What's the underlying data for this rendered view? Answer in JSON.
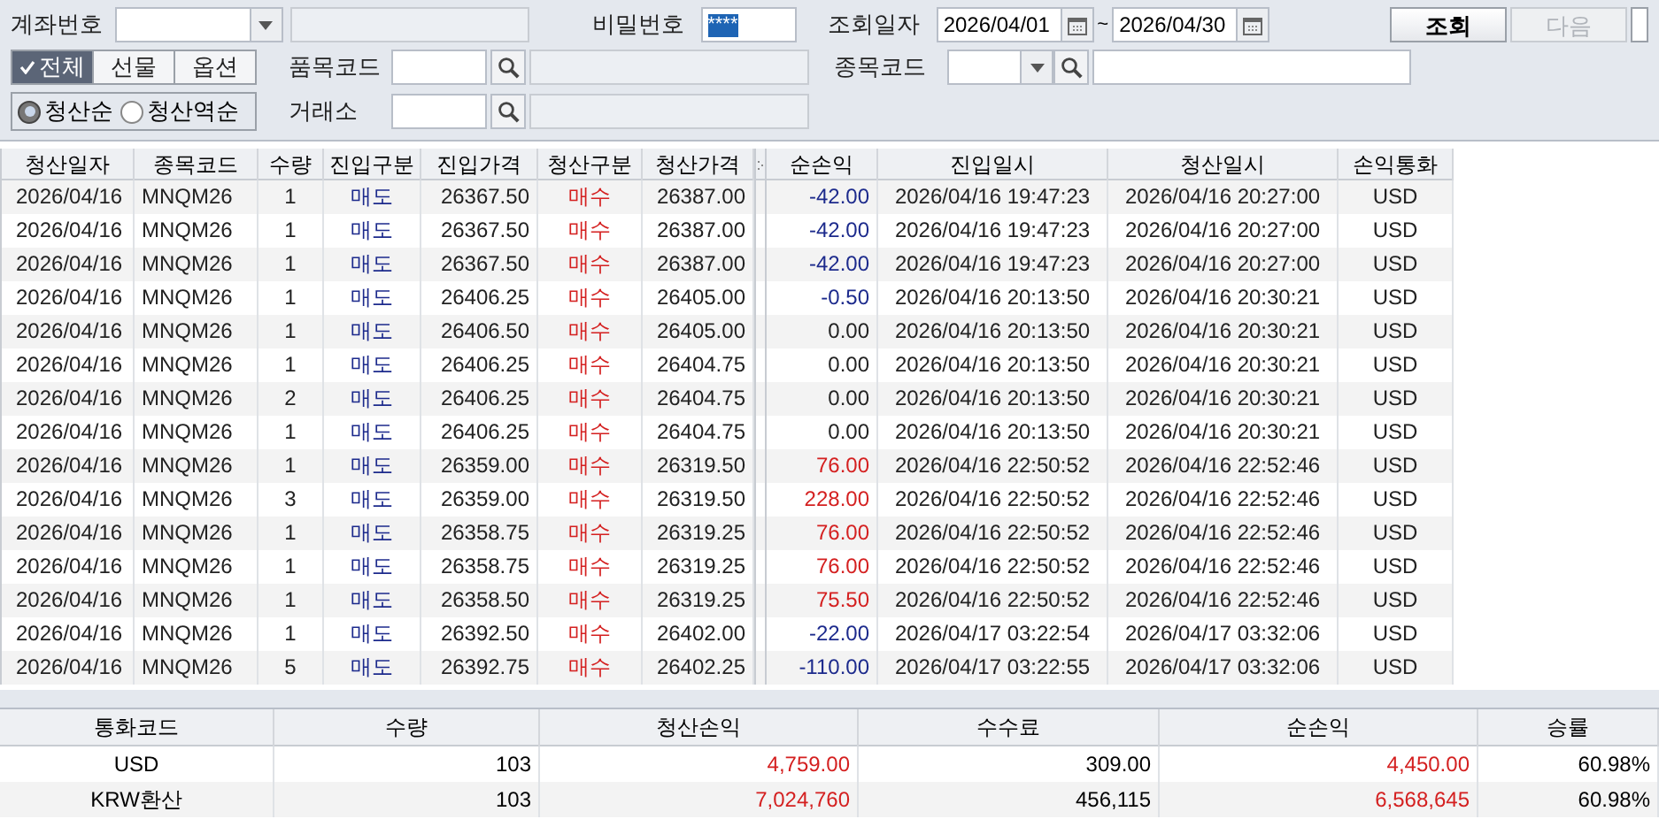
{
  "filters": {
    "account": {
      "label": "계좌번호"
    },
    "password": {
      "label": "비밀번호",
      "value": "****"
    },
    "date_range": {
      "label": "조회일자",
      "from": "2026/04/01",
      "separator": "~",
      "to": "2026/04/30"
    },
    "search_button": "조회",
    "next_button": {
      "label": "다음",
      "disabled": true
    },
    "market_tabs": [
      {
        "label": "전체",
        "selected": true
      },
      {
        "label": "선물",
        "selected": false
      },
      {
        "label": "옵션",
        "selected": false
      }
    ],
    "product_code": {
      "label": "품목코드"
    },
    "item_code": {
      "label": "종목코드"
    },
    "sort_options": [
      {
        "label": "청산순",
        "selected": true
      },
      {
        "label": "청산역순",
        "selected": false
      }
    ],
    "exchange": {
      "label": "거래소"
    }
  },
  "table": {
    "columns": [
      "청산일자",
      "종목코드",
      "수량",
      "진입구분",
      "진입가격",
      "청산구분",
      "청산가격",
      "순손익",
      "진입일시",
      "청산일시",
      "손익통화"
    ],
    "rows": [
      {
        "kind": "loss",
        "cells": [
          "2026/04/16",
          "MNQM26",
          "1",
          "매도",
          "26367.50",
          "매수",
          "26387.00",
          "-42.00",
          "2026/04/16 19:47:23",
          "2026/04/16 20:27:00",
          "USD"
        ]
      },
      {
        "kind": "loss",
        "cells": [
          "2026/04/16",
          "MNQM26",
          "1",
          "매도",
          "26367.50",
          "매수",
          "26387.00",
          "-42.00",
          "2026/04/16 19:47:23",
          "2026/04/16 20:27:00",
          "USD"
        ]
      },
      {
        "kind": "loss",
        "cells": [
          "2026/04/16",
          "MNQM26",
          "1",
          "매도",
          "26367.50",
          "매수",
          "26387.00",
          "-42.00",
          "2026/04/16 19:47:23",
          "2026/04/16 20:27:00",
          "USD"
        ]
      },
      {
        "kind": "loss",
        "cells": [
          "2026/04/16",
          "MNQM26",
          "1",
          "매도",
          "26406.25",
          "매수",
          "26405.00",
          "-0.50",
          "2026/04/16 20:13:50",
          "2026/04/16 20:30:21",
          "USD"
        ]
      },
      {
        "kind": "flat",
        "cells": [
          "2026/04/16",
          "MNQM26",
          "1",
          "매도",
          "26406.50",
          "매수",
          "26405.00",
          "0.00",
          "2026/04/16 20:13:50",
          "2026/04/16 20:30:21",
          "USD"
        ]
      },
      {
        "kind": "flat",
        "cells": [
          "2026/04/16",
          "MNQM26",
          "1",
          "매도",
          "26406.25",
          "매수",
          "26404.75",
          "0.00",
          "2026/04/16 20:13:50",
          "2026/04/16 20:30:21",
          "USD"
        ]
      },
      {
        "kind": "flat",
        "cells": [
          "2026/04/16",
          "MNQM26",
          "2",
          "매도",
          "26406.25",
          "매수",
          "26404.75",
          "0.00",
          "2026/04/16 20:13:50",
          "2026/04/16 20:30:21",
          "USD"
        ]
      },
      {
        "kind": "flat",
        "cells": [
          "2026/04/16",
          "MNQM26",
          "1",
          "매도",
          "26406.25",
          "매수",
          "26404.75",
          "0.00",
          "2026/04/16 20:13:50",
          "2026/04/16 20:30:21",
          "USD"
        ]
      },
      {
        "kind": "profit",
        "cells": [
          "2026/04/16",
          "MNQM26",
          "1",
          "매도",
          "26359.00",
          "매수",
          "26319.50",
          "76.00",
          "2026/04/16 22:50:52",
          "2026/04/16 22:52:46",
          "USD"
        ]
      },
      {
        "kind": "profit",
        "cells": [
          "2026/04/16",
          "MNQM26",
          "3",
          "매도",
          "26359.00",
          "매수",
          "26319.50",
          "228.00",
          "2026/04/16 22:50:52",
          "2026/04/16 22:52:46",
          "USD"
        ]
      },
      {
        "kind": "profit",
        "cells": [
          "2026/04/16",
          "MNQM26",
          "1",
          "매도",
          "26358.75",
          "매수",
          "26319.25",
          "76.00",
          "2026/04/16 22:50:52",
          "2026/04/16 22:52:46",
          "USD"
        ]
      },
      {
        "kind": "profit",
        "cells": [
          "2026/04/16",
          "MNQM26",
          "1",
          "매도",
          "26358.75",
          "매수",
          "26319.25",
          "76.00",
          "2026/04/16 22:50:52",
          "2026/04/16 22:52:46",
          "USD"
        ]
      },
      {
        "kind": "profit",
        "cells": [
          "2026/04/16",
          "MNQM26",
          "1",
          "매도",
          "26358.50",
          "매수",
          "26319.25",
          "75.50",
          "2026/04/16 22:50:52",
          "2026/04/16 22:52:46",
          "USD"
        ]
      },
      {
        "kind": "loss",
        "cells": [
          "2026/04/16",
          "MNQM26",
          "1",
          "매도",
          "26392.50",
          "매수",
          "26402.00",
          "-22.00",
          "2026/04/17 03:22:54",
          "2026/04/17 03:32:06",
          "USD"
        ]
      },
      {
        "kind": "loss",
        "cells": [
          "2026/04/16",
          "MNQM26",
          "5",
          "매도",
          "26392.75",
          "매수",
          "26402.25",
          "-110.00",
          "2026/04/17 03:22:55",
          "2026/04/17 03:32:06",
          "USD"
        ]
      }
    ]
  },
  "summary": {
    "columns": [
      "통화코드",
      "수량",
      "청산손익",
      "수수료",
      "순손익",
      "승률"
    ],
    "rows": [
      {
        "cells": [
          "USD",
          "103",
          "4,759.00",
          "309.00",
          "4,450.00",
          "60.98%"
        ]
      },
      {
        "cells": [
          "KRW환산",
          "103",
          "7,024,760",
          "456,115",
          "6,568,645",
          "60.98%"
        ]
      }
    ]
  }
}
